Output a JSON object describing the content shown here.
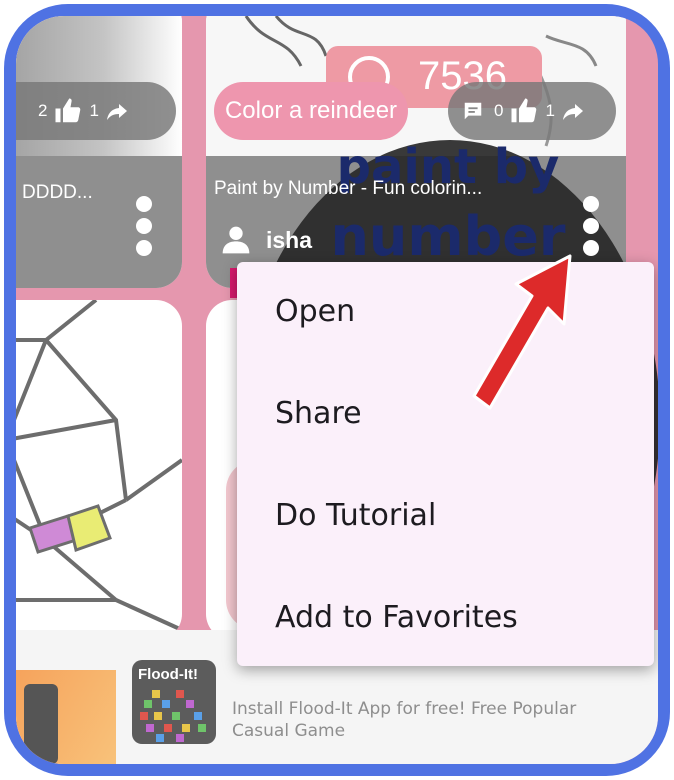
{
  "feed": {
    "left_card": {
      "comments": "2",
      "likes": "1",
      "title": "DDDD..."
    },
    "center_card": {
      "badge": "Color a reindeer",
      "score": "7536",
      "comments": "0",
      "likes": "1",
      "title": "Paint by Number - Fun colorin...",
      "author": "isha",
      "logo_line1": "paint by",
      "logo_line2": "number"
    }
  },
  "context_menu": {
    "items": [
      "Open",
      "Share",
      "Do Tutorial",
      "Add to Favorites"
    ]
  },
  "ad": {
    "app_icon_label": "Flood-It!",
    "text": "Install Flood-It App for free! Free Popular Casual Game"
  },
  "colors": {
    "frame": "#4f72e3",
    "background": "#e597ae",
    "menu": "#fbf0fa",
    "arrow": "#dd2a2a"
  }
}
